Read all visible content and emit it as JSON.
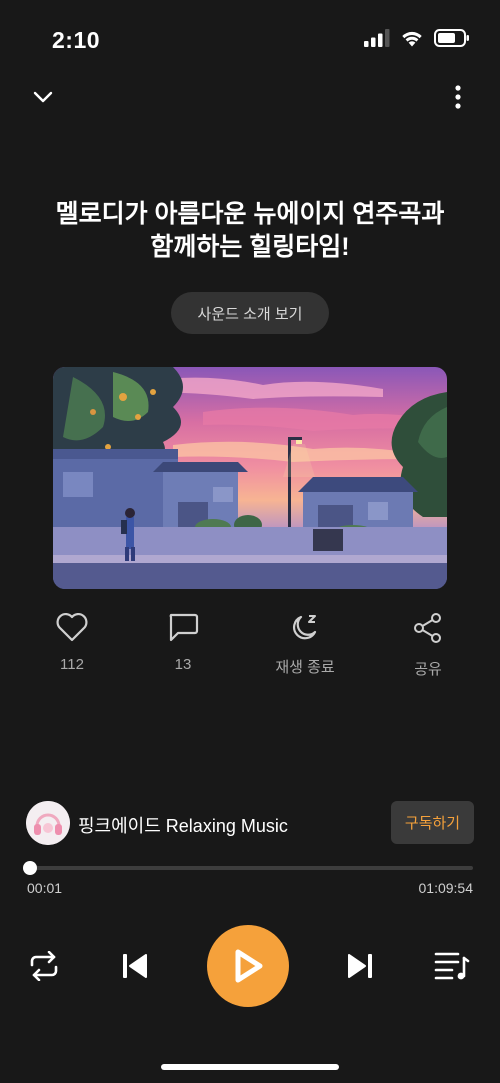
{
  "status_bar": {
    "time": "2:10"
  },
  "header": {
    "collapse_icon": "chevron-down-icon",
    "menu_icon": "more-vertical-icon"
  },
  "content": {
    "title_line1": "멜로디가 아름다운 뉴에이지 연주곡과",
    "title_line2": "함께하는 힐링타임!",
    "sound_intro_button": "사운드 소개 보기"
  },
  "actions": {
    "like_count": "112",
    "comment_count": "13",
    "sleep_timer_label": "재생 종료",
    "share_label": "공유"
  },
  "channel": {
    "name": "핑크에이드 Relaxing Music",
    "subscribe_label": "구독하기"
  },
  "player": {
    "current_time": "00:01",
    "total_time": "01:09:54",
    "progress_fraction": 0.0002
  },
  "colors": {
    "accent": "#f5a13b",
    "background": "#181818"
  }
}
